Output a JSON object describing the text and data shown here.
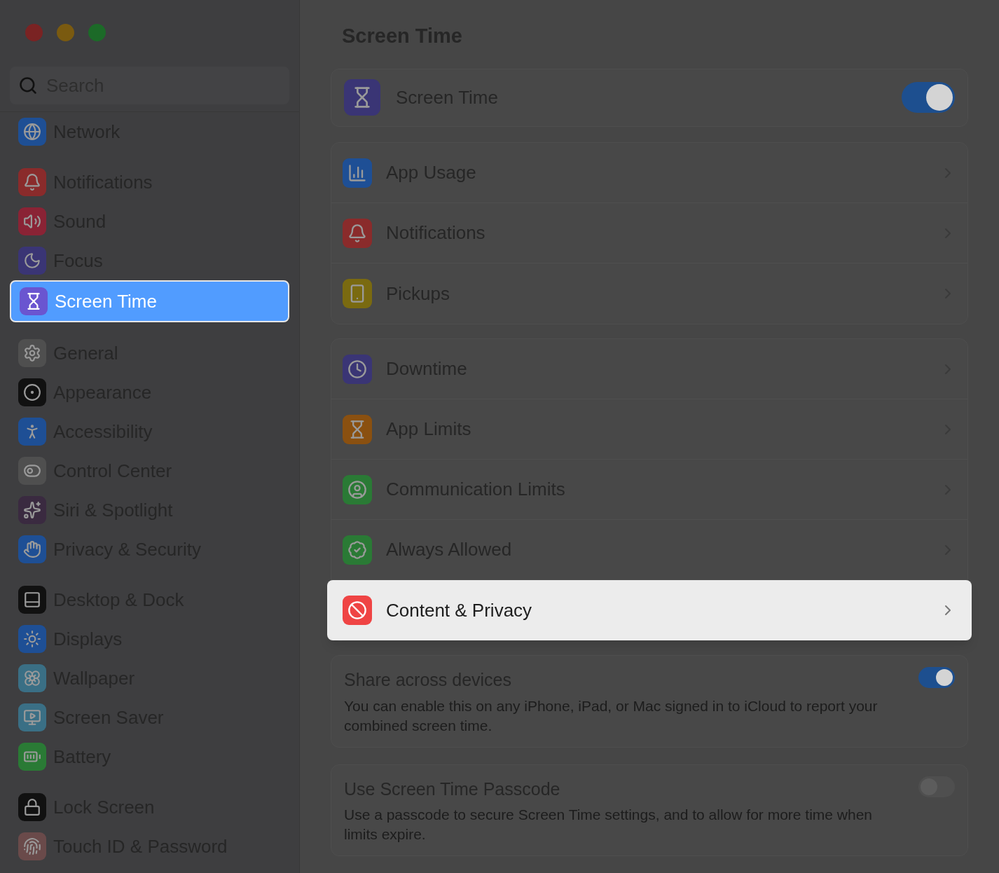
{
  "window": {
    "title": "Screen Time"
  },
  "sidebar": {
    "search": {
      "placeholder": "Search"
    },
    "groups": [
      {
        "items": [
          {
            "label": "Network",
            "selected": false
          }
        ]
      },
      {
        "items": [
          {
            "label": "Notifications",
            "selected": false
          },
          {
            "label": "Sound",
            "selected": false
          },
          {
            "label": "Focus",
            "selected": false
          },
          {
            "label": "Screen Time",
            "selected": true
          }
        ]
      },
      {
        "items": [
          {
            "label": "General",
            "selected": false
          },
          {
            "label": "Appearance",
            "selected": false
          },
          {
            "label": "Accessibility",
            "selected": false
          },
          {
            "label": "Control Center",
            "selected": false
          },
          {
            "label": "Siri & Spotlight",
            "selected": false
          },
          {
            "label": "Privacy & Security",
            "selected": false
          }
        ]
      },
      {
        "items": [
          {
            "label": "Desktop & Dock",
            "selected": false
          },
          {
            "label": "Displays",
            "selected": false
          },
          {
            "label": "Wallpaper",
            "selected": false
          },
          {
            "label": "Screen Saver",
            "selected": false
          },
          {
            "label": "Battery",
            "selected": false
          }
        ]
      },
      {
        "items": [
          {
            "label": "Lock Screen",
            "selected": false
          },
          {
            "label": "Touch ID & Password",
            "selected": false
          }
        ]
      }
    ]
  },
  "main": {
    "master": {
      "label": "Screen Time",
      "on": true
    },
    "groups": [
      {
        "rows": [
          {
            "label": "App Usage",
            "highlighted": false
          },
          {
            "label": "Notifications",
            "highlighted": false
          },
          {
            "label": "Pickups",
            "highlighted": false
          }
        ]
      },
      {
        "rows": [
          {
            "label": "Downtime",
            "highlighted": false
          },
          {
            "label": "App Limits",
            "highlighted": false
          },
          {
            "label": "Communication Limits",
            "highlighted": false
          },
          {
            "label": "Always Allowed",
            "highlighted": false
          },
          {
            "label": "Content & Privacy",
            "highlighted": true
          }
        ]
      }
    ],
    "options": [
      {
        "label": "Share across devices",
        "description": "You can enable this on any iPhone, iPad, or Mac signed in to iCloud to report your combined screen time.",
        "on": true
      },
      {
        "label": "Use Screen Time Passcode",
        "description": "Use a passcode to secure Screen Time settings, and to allow for more time when limits expire.",
        "on": false
      }
    ]
  }
}
